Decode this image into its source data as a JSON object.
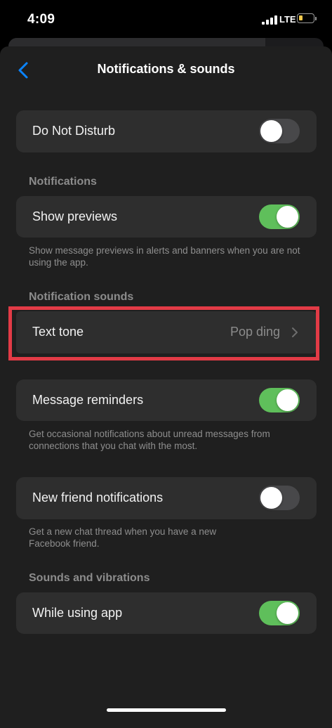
{
  "status_bar": {
    "time": "4:09",
    "network": "LTE"
  },
  "nav": {
    "title": "Notifications & sounds"
  },
  "dnd": {
    "label": "Do Not Disturb",
    "on": false
  },
  "notifications": {
    "header": "Notifications",
    "show_previews": {
      "label": "Show previews",
      "on": true
    },
    "footnote": "Show message previews in alerts and banners when you are not using the app."
  },
  "sounds": {
    "header": "Notification sounds",
    "text_tone": {
      "label": "Text tone",
      "value": "Pop ding"
    }
  },
  "reminders": {
    "label": "Message reminders",
    "on": true,
    "footnote": "Get occasional notifications about unread messages from connections that you chat with the most."
  },
  "new_friend": {
    "label": "New friend notifications",
    "on": false,
    "footnote": "Get a new chat thread when you have a new Facebook friend."
  },
  "vibrations": {
    "header": "Sounds and vibrations",
    "while_using": {
      "label": "While using app",
      "on": true
    }
  },
  "colors": {
    "accent": "#0a84ff",
    "toggle_on": "#5fbf5b",
    "highlight": "#e23b46"
  },
  "icons": [
    "back-chevron-icon",
    "chevron-right-icon",
    "signal-icon",
    "battery-icon"
  ]
}
